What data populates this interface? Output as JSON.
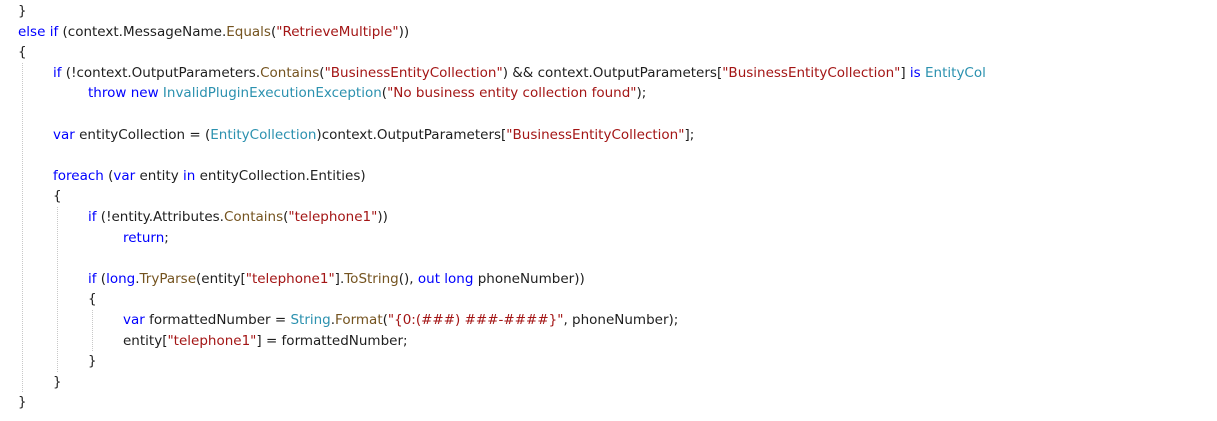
{
  "colors": {
    "background": "#ffffff",
    "keyword": "#0000ff",
    "type": "#2b91af",
    "method": "#74531f",
    "string": "#a31515",
    "plain": "#1e1e1e",
    "indent_guide": "#c8c8c8"
  },
  "code_lines": [
    {
      "indent": 0,
      "tokens": [
        [
          "plain",
          "}"
        ]
      ]
    },
    {
      "indent": 0,
      "tokens": [
        [
          "keyword",
          "else"
        ],
        [
          "plain",
          " "
        ],
        [
          "keyword",
          "if"
        ],
        [
          "plain",
          " (context.MessageName."
        ],
        [
          "method",
          "Equals"
        ],
        [
          "plain",
          "("
        ],
        [
          "string",
          "\"RetrieveMultiple\""
        ],
        [
          "plain",
          "))"
        ]
      ]
    },
    {
      "indent": 0,
      "tokens": [
        [
          "plain",
          "{"
        ]
      ]
    },
    {
      "indent": 1,
      "tokens": [
        [
          "keyword",
          "if"
        ],
        [
          "plain",
          " (!context.OutputParameters."
        ],
        [
          "method",
          "Contains"
        ],
        [
          "plain",
          "("
        ],
        [
          "string",
          "\"BusinessEntityCollection\""
        ],
        [
          "plain",
          ") && context.OutputParameters["
        ],
        [
          "string",
          "\"BusinessEntityCollection\""
        ],
        [
          "plain",
          "] "
        ],
        [
          "keyword",
          "is"
        ],
        [
          "plain",
          " "
        ],
        [
          "type",
          "EntityCol"
        ]
      ]
    },
    {
      "indent": 2,
      "tokens": [
        [
          "keyword",
          "throw"
        ],
        [
          "plain",
          " "
        ],
        [
          "keyword",
          "new"
        ],
        [
          "plain",
          " "
        ],
        [
          "type",
          "InvalidPluginExecutionException"
        ],
        [
          "plain",
          "("
        ],
        [
          "string",
          "\"No business entity collection found\""
        ],
        [
          "plain",
          ");"
        ]
      ]
    },
    {
      "indent": 0,
      "tokens": []
    },
    {
      "indent": 1,
      "tokens": [
        [
          "keyword",
          "var"
        ],
        [
          "plain",
          " entityCollection = ("
        ],
        [
          "type",
          "EntityCollection"
        ],
        [
          "plain",
          ")context.OutputParameters["
        ],
        [
          "string",
          "\"BusinessEntityCollection\""
        ],
        [
          "plain",
          "];"
        ]
      ]
    },
    {
      "indent": 0,
      "tokens": []
    },
    {
      "indent": 1,
      "tokens": [
        [
          "keyword",
          "foreach"
        ],
        [
          "plain",
          " ("
        ],
        [
          "keyword",
          "var"
        ],
        [
          "plain",
          " entity "
        ],
        [
          "keyword",
          "in"
        ],
        [
          "plain",
          " entityCollection.Entities)"
        ]
      ]
    },
    {
      "indent": 1,
      "tokens": [
        [
          "plain",
          "{"
        ]
      ]
    },
    {
      "indent": 2,
      "tokens": [
        [
          "keyword",
          "if"
        ],
        [
          "plain",
          " (!entity.Attributes."
        ],
        [
          "method",
          "Contains"
        ],
        [
          "plain",
          "("
        ],
        [
          "string",
          "\"telephone1\""
        ],
        [
          "plain",
          "))"
        ]
      ]
    },
    {
      "indent": 3,
      "tokens": [
        [
          "keyword",
          "return"
        ],
        [
          "plain",
          ";"
        ]
      ]
    },
    {
      "indent": 0,
      "tokens": []
    },
    {
      "indent": 2,
      "tokens": [
        [
          "keyword",
          "if"
        ],
        [
          "plain",
          " ("
        ],
        [
          "keyword",
          "long"
        ],
        [
          "plain",
          "."
        ],
        [
          "method",
          "TryParse"
        ],
        [
          "plain",
          "(entity["
        ],
        [
          "string",
          "\"telephone1\""
        ],
        [
          "plain",
          "]."
        ],
        [
          "method",
          "ToString"
        ],
        [
          "plain",
          "(), "
        ],
        [
          "keyword",
          "out"
        ],
        [
          "plain",
          " "
        ],
        [
          "keyword",
          "long"
        ],
        [
          "plain",
          " phoneNumber))"
        ]
      ]
    },
    {
      "indent": 2,
      "tokens": [
        [
          "plain",
          "{"
        ]
      ]
    },
    {
      "indent": 3,
      "tokens": [
        [
          "keyword",
          "var"
        ],
        [
          "plain",
          " formattedNumber = "
        ],
        [
          "type",
          "String"
        ],
        [
          "plain",
          "."
        ],
        [
          "method",
          "Format"
        ],
        [
          "plain",
          "("
        ],
        [
          "string",
          "\"{0:(###) ###-####}\""
        ],
        [
          "plain",
          ", phoneNumber);"
        ]
      ]
    },
    {
      "indent": 3,
      "tokens": [
        [
          "plain",
          "entity["
        ],
        [
          "string",
          "\"telephone1\""
        ],
        [
          "plain",
          "] = formattedNumber;"
        ]
      ]
    },
    {
      "indent": 2,
      "tokens": [
        [
          "plain",
          "}"
        ]
      ]
    },
    {
      "indent": 1,
      "tokens": [
        [
          "plain",
          "}"
        ]
      ]
    },
    {
      "indent": 0,
      "tokens": [
        [
          "plain",
          "}"
        ]
      ]
    }
  ]
}
